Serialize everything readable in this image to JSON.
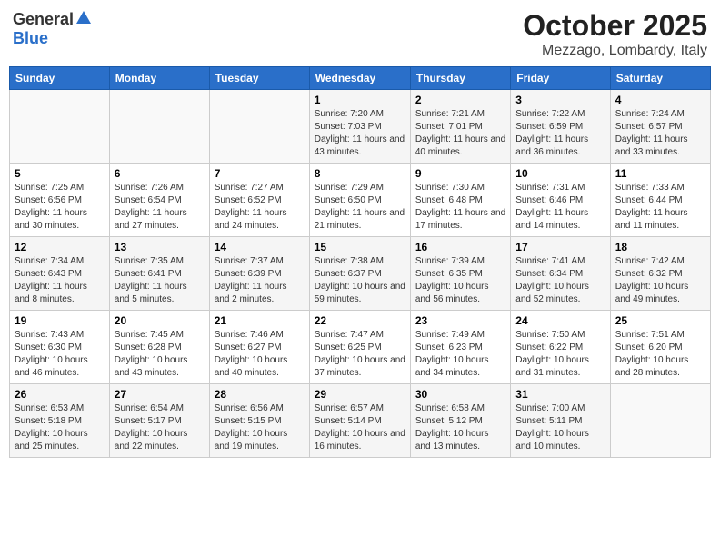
{
  "header": {
    "logo_general": "General",
    "logo_blue": "Blue",
    "month_title": "October 2025",
    "location": "Mezzago, Lombardy, Italy"
  },
  "weekdays": [
    "Sunday",
    "Monday",
    "Tuesday",
    "Wednesday",
    "Thursday",
    "Friday",
    "Saturday"
  ],
  "weeks": [
    [
      {
        "day": "",
        "info": ""
      },
      {
        "day": "",
        "info": ""
      },
      {
        "day": "",
        "info": ""
      },
      {
        "day": "1",
        "info": "Sunrise: 7:20 AM\nSunset: 7:03 PM\nDaylight: 11 hours and 43 minutes."
      },
      {
        "day": "2",
        "info": "Sunrise: 7:21 AM\nSunset: 7:01 PM\nDaylight: 11 hours and 40 minutes."
      },
      {
        "day": "3",
        "info": "Sunrise: 7:22 AM\nSunset: 6:59 PM\nDaylight: 11 hours and 36 minutes."
      },
      {
        "day": "4",
        "info": "Sunrise: 7:24 AM\nSunset: 6:57 PM\nDaylight: 11 hours and 33 minutes."
      }
    ],
    [
      {
        "day": "5",
        "info": "Sunrise: 7:25 AM\nSunset: 6:56 PM\nDaylight: 11 hours and 30 minutes."
      },
      {
        "day": "6",
        "info": "Sunrise: 7:26 AM\nSunset: 6:54 PM\nDaylight: 11 hours and 27 minutes."
      },
      {
        "day": "7",
        "info": "Sunrise: 7:27 AM\nSunset: 6:52 PM\nDaylight: 11 hours and 24 minutes."
      },
      {
        "day": "8",
        "info": "Sunrise: 7:29 AM\nSunset: 6:50 PM\nDaylight: 11 hours and 21 minutes."
      },
      {
        "day": "9",
        "info": "Sunrise: 7:30 AM\nSunset: 6:48 PM\nDaylight: 11 hours and 17 minutes."
      },
      {
        "day": "10",
        "info": "Sunrise: 7:31 AM\nSunset: 6:46 PM\nDaylight: 11 hours and 14 minutes."
      },
      {
        "day": "11",
        "info": "Sunrise: 7:33 AM\nSunset: 6:44 PM\nDaylight: 11 hours and 11 minutes."
      }
    ],
    [
      {
        "day": "12",
        "info": "Sunrise: 7:34 AM\nSunset: 6:43 PM\nDaylight: 11 hours and 8 minutes."
      },
      {
        "day": "13",
        "info": "Sunrise: 7:35 AM\nSunset: 6:41 PM\nDaylight: 11 hours and 5 minutes."
      },
      {
        "day": "14",
        "info": "Sunrise: 7:37 AM\nSunset: 6:39 PM\nDaylight: 11 hours and 2 minutes."
      },
      {
        "day": "15",
        "info": "Sunrise: 7:38 AM\nSunset: 6:37 PM\nDaylight: 10 hours and 59 minutes."
      },
      {
        "day": "16",
        "info": "Sunrise: 7:39 AM\nSunset: 6:35 PM\nDaylight: 10 hours and 56 minutes."
      },
      {
        "day": "17",
        "info": "Sunrise: 7:41 AM\nSunset: 6:34 PM\nDaylight: 10 hours and 52 minutes."
      },
      {
        "day": "18",
        "info": "Sunrise: 7:42 AM\nSunset: 6:32 PM\nDaylight: 10 hours and 49 minutes."
      }
    ],
    [
      {
        "day": "19",
        "info": "Sunrise: 7:43 AM\nSunset: 6:30 PM\nDaylight: 10 hours and 46 minutes."
      },
      {
        "day": "20",
        "info": "Sunrise: 7:45 AM\nSunset: 6:28 PM\nDaylight: 10 hours and 43 minutes."
      },
      {
        "day": "21",
        "info": "Sunrise: 7:46 AM\nSunset: 6:27 PM\nDaylight: 10 hours and 40 minutes."
      },
      {
        "day": "22",
        "info": "Sunrise: 7:47 AM\nSunset: 6:25 PM\nDaylight: 10 hours and 37 minutes."
      },
      {
        "day": "23",
        "info": "Sunrise: 7:49 AM\nSunset: 6:23 PM\nDaylight: 10 hours and 34 minutes."
      },
      {
        "day": "24",
        "info": "Sunrise: 7:50 AM\nSunset: 6:22 PM\nDaylight: 10 hours and 31 minutes."
      },
      {
        "day": "25",
        "info": "Sunrise: 7:51 AM\nSunset: 6:20 PM\nDaylight: 10 hours and 28 minutes."
      }
    ],
    [
      {
        "day": "26",
        "info": "Sunrise: 6:53 AM\nSunset: 5:18 PM\nDaylight: 10 hours and 25 minutes."
      },
      {
        "day": "27",
        "info": "Sunrise: 6:54 AM\nSunset: 5:17 PM\nDaylight: 10 hours and 22 minutes."
      },
      {
        "day": "28",
        "info": "Sunrise: 6:56 AM\nSunset: 5:15 PM\nDaylight: 10 hours and 19 minutes."
      },
      {
        "day": "29",
        "info": "Sunrise: 6:57 AM\nSunset: 5:14 PM\nDaylight: 10 hours and 16 minutes."
      },
      {
        "day": "30",
        "info": "Sunrise: 6:58 AM\nSunset: 5:12 PM\nDaylight: 10 hours and 13 minutes."
      },
      {
        "day": "31",
        "info": "Sunrise: 7:00 AM\nSunset: 5:11 PM\nDaylight: 10 hours and 10 minutes."
      },
      {
        "day": "",
        "info": ""
      }
    ]
  ]
}
